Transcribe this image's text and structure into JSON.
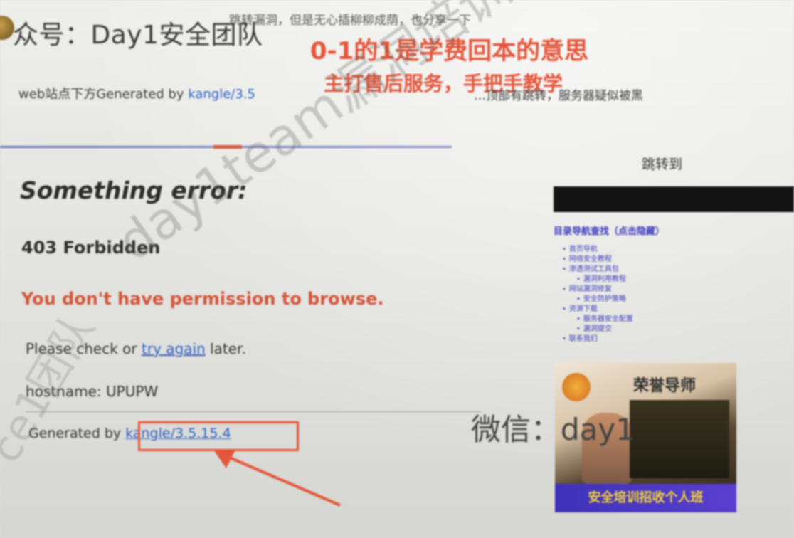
{
  "header": {
    "account_title": "众号：Day1安全团队",
    "caption": "跳转漏洞，但是无心插柳柳成荫，也分享一下",
    "red_line1": "0-1的1是学费回本的意思",
    "red_line2": "主打售后服务，手把手教学"
  },
  "description": {
    "prefix": "web站点下方Generated by ",
    "link_text": "kangle/3.5",
    "suffix": "…顶部有跳转，服务器疑似被黑"
  },
  "error_page": {
    "title": "Something error:",
    "code": "403 Forbidden",
    "message": "You don't have permission to browse.",
    "check_prefix": "Please check or ",
    "check_link": "try again",
    "check_suffix": " later.",
    "hostname": "hostname: UPUPW",
    "generated_prefix": "Generated by ",
    "generated_link": "kangle/3.5.15.4"
  },
  "sidebar": {
    "title": "跳转到",
    "heading": "目录导航查找（点击隐藏）",
    "items": [
      {
        "label": "首页导航",
        "level": 0
      },
      {
        "label": "网络安全教程",
        "level": 0
      },
      {
        "label": "渗透测试工具包",
        "level": 0
      },
      {
        "label": "漏洞利用教程",
        "level": 1
      },
      {
        "label": "网站漏洞修复",
        "level": 0
      },
      {
        "label": "安全防护策略",
        "level": 1
      },
      {
        "label": "资源下载",
        "level": 0
      },
      {
        "label": "服务器安全配置",
        "level": 1
      },
      {
        "label": "漏洞提交",
        "level": 1
      },
      {
        "label": "联系我们",
        "level": 0
      }
    ]
  },
  "promo": {
    "wechat_label": "微信：day1",
    "banner_caption": "荣誉导师",
    "banner_strip": "安全培训招收个人班"
  },
  "watermark": {
    "main": "day1team漏洞培训微信：day1team",
    "side": "ce1团队"
  },
  "colors": {
    "accent_red": "#e4553a",
    "link_blue": "#2e5fc4",
    "sidebar_blue": "#3b3bbd"
  }
}
